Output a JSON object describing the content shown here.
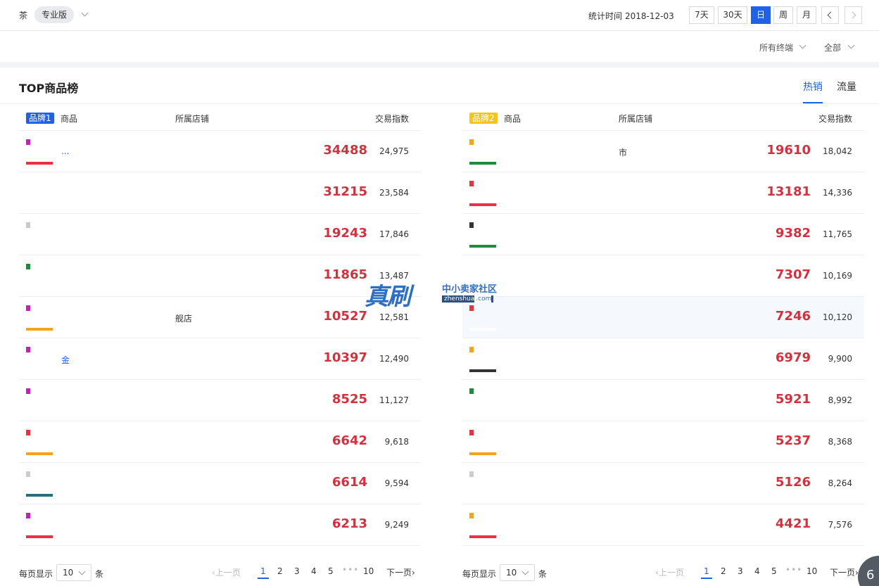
{
  "topbar": {
    "category": "茶",
    "edition": "专业版",
    "stat_label": "统计时间",
    "stat_date": "2018-12-03",
    "ranges": [
      "7天",
      "30天",
      "日",
      "周",
      "月"
    ],
    "active_range": "日"
  },
  "filters": {
    "terminal": "所有终端",
    "scope": "全部"
  },
  "module": {
    "title": "TOP商品榜",
    "tabs": [
      "热销",
      "流量"
    ],
    "active_tab": "热销"
  },
  "table_headers": {
    "product": "商品",
    "shop": "所属店铺",
    "index": "交易指数"
  },
  "colors": {
    "accent": "#2062e6",
    "value_red": "#d0333f",
    "brand1": "#2062e6",
    "brand2": "#f5c518"
  },
  "panels": [
    {
      "brand": "品牌1",
      "rows": [
        {
          "name": "...",
          "shop": "",
          "value": "34488",
          "index": "24,975"
        },
        {
          "name": "",
          "shop": "",
          "value": "31215",
          "index": "23,584"
        },
        {
          "name": "",
          "shop": "",
          "value": "19243",
          "index": "17,846"
        },
        {
          "name": "",
          "shop": "",
          "value": "11865",
          "index": "13,487"
        },
        {
          "name": "",
          "shop": "舰店",
          "value": "10527",
          "index": "12,581"
        },
        {
          "name": "金",
          "shop": "",
          "value": "10397",
          "index": "12,490"
        },
        {
          "name": "",
          "shop": "",
          "value": "8525",
          "index": "11,127"
        },
        {
          "name": "",
          "shop": "",
          "value": "6642",
          "index": "9,618"
        },
        {
          "name": "",
          "shop": "",
          "value": "6614",
          "index": "9,594"
        },
        {
          "name": "",
          "shop": "",
          "value": "6213",
          "index": "9,249"
        }
      ]
    },
    {
      "brand": "品牌2",
      "rows": [
        {
          "name": "",
          "shop": "市",
          "value": "19610",
          "index": "18,042"
        },
        {
          "name": "",
          "shop": "",
          "value": "13181",
          "index": "14,336"
        },
        {
          "name": "",
          "shop": "",
          "value": "9382",
          "index": "11,765"
        },
        {
          "name": "",
          "shop": "",
          "value": "7307",
          "index": "10,169"
        },
        {
          "name": "",
          "shop": "",
          "value": "7246",
          "index": "10,120"
        },
        {
          "name": "",
          "shop": "",
          "value": "6979",
          "index": "9,900"
        },
        {
          "name": "",
          "shop": "",
          "value": "5921",
          "index": "8,992"
        },
        {
          "name": "",
          "shop": "",
          "value": "5237",
          "index": "8,368"
        },
        {
          "name": "",
          "shop": "",
          "value": "5126",
          "index": "8,264"
        },
        {
          "name": "",
          "shop": "",
          "value": "4421",
          "index": "7,576"
        }
      ]
    }
  ],
  "pagination": {
    "per_page_label": "每页显示",
    "per_page_value": "10",
    "unit": "条",
    "prev": "上一页",
    "next": "下一页",
    "pages": [
      "1",
      "2",
      "3",
      "4",
      "5"
    ],
    "ellipsis": "•••",
    "last_page": "10",
    "current": "1"
  },
  "watermark": {
    "big": "真刷",
    "small": "中小卖家社区",
    "url": "zhenshua",
    "url_suffix": ".com"
  },
  "corner_badge": "6"
}
